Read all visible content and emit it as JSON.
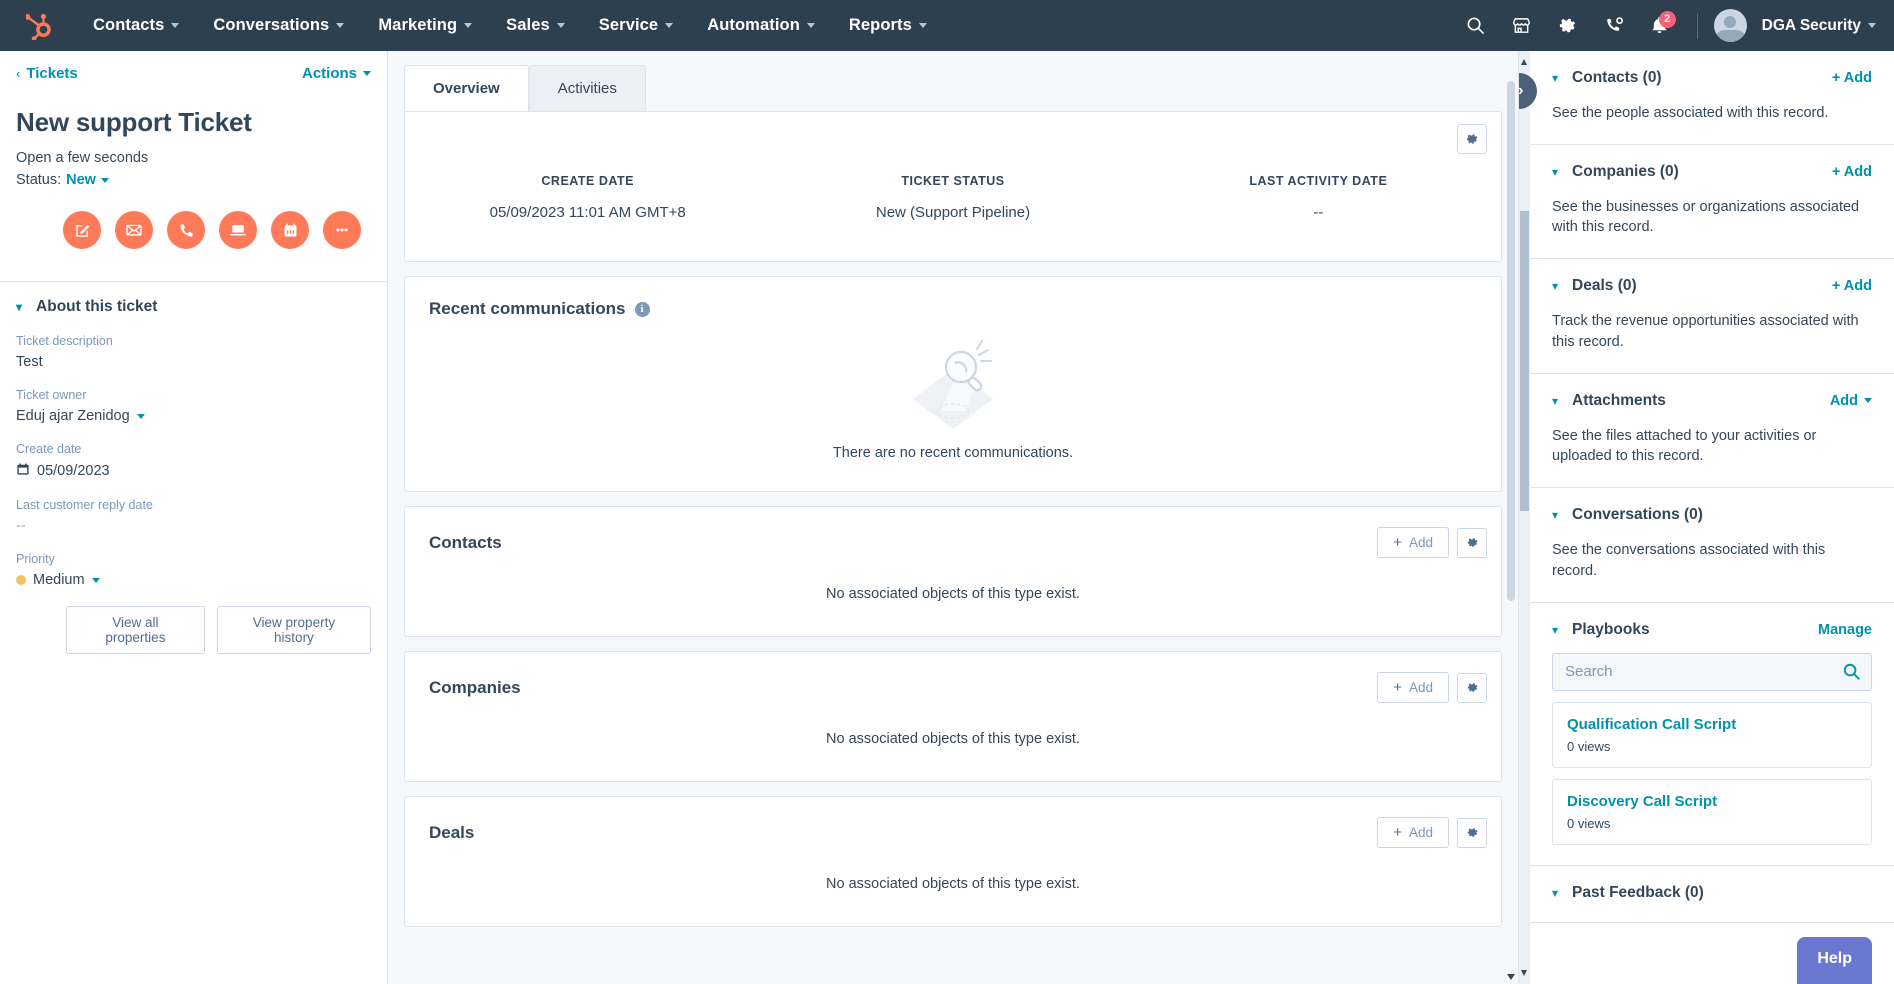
{
  "topnav": {
    "logo_icon": "hubspot-logo-icon",
    "menu": [
      {
        "label": "Contacts",
        "icon": "chevron-down-icon"
      },
      {
        "label": "Conversations",
        "icon": "chevron-down-icon"
      },
      {
        "label": "Marketing",
        "icon": "chevron-down-icon"
      },
      {
        "label": "Sales",
        "icon": "chevron-down-icon"
      },
      {
        "label": "Service",
        "icon": "chevron-down-icon"
      },
      {
        "label": "Automation",
        "icon": "chevron-down-icon"
      },
      {
        "label": "Reports",
        "icon": "chevron-down-icon"
      }
    ],
    "icons": [
      {
        "name": "search-icon"
      },
      {
        "name": "marketplace-icon"
      },
      {
        "name": "gear-icon"
      },
      {
        "name": "calling-icon"
      },
      {
        "name": "notifications-bell-icon"
      }
    ],
    "notification_count": "2",
    "account": {
      "name": "DGA Security",
      "avatar": "user-avatar-icon"
    },
    "accent_color": "#ff7a59",
    "background_color": "#2e3f50"
  },
  "left_panel": {
    "breadcrumb": "Tickets",
    "actions_label": "Actions",
    "record_title": "New support Ticket",
    "record_subtitle": "Open a few seconds",
    "status_label": "Status:",
    "status_value": "New",
    "quick_actions": [
      {
        "name": "note-icon",
        "label": "Note"
      },
      {
        "name": "email-icon",
        "label": "Email"
      },
      {
        "name": "call-icon",
        "label": "Call"
      },
      {
        "name": "meeting-icon",
        "label": "Meeting"
      },
      {
        "name": "task-icon",
        "label": "Task"
      },
      {
        "name": "more-ellipsis-icon",
        "label": "More"
      }
    ],
    "about_section_title": "About this ticket",
    "properties": [
      {
        "label": "Ticket description",
        "value": "Test",
        "type": "text"
      },
      {
        "label": "Ticket owner",
        "value": "Eduj ajar Zenidog",
        "type": "dropdown"
      },
      {
        "label": "Create date",
        "value": "05/09/2023",
        "type": "date"
      },
      {
        "label": "Last customer reply date",
        "value": "--",
        "type": "empty"
      },
      {
        "label": "Priority",
        "value": "Medium",
        "type": "priority",
        "dot_color": "#f5c26b"
      }
    ],
    "buttons": [
      {
        "label": "View all properties"
      },
      {
        "label": "View property history"
      }
    ]
  },
  "center": {
    "tabs": [
      {
        "label": "Overview",
        "active": true
      },
      {
        "label": "Activities",
        "active": false
      }
    ],
    "summary": {
      "columns": [
        {
          "label": "CREATE DATE",
          "value": "05/09/2023 11:01 AM GMT+8"
        },
        {
          "label": "TICKET STATUS",
          "value": "New (Support Pipeline)"
        },
        {
          "label": "LAST ACTIVITY DATE",
          "value": "--"
        }
      ],
      "gear_icon": "gear-icon"
    },
    "recent_communications": {
      "title": "Recent communications",
      "info_icon": "info-icon",
      "empty_text": "There are no recent communications.",
      "illustration": "magnifier-empty-state-icon"
    },
    "association_cards": [
      {
        "title": "Contacts",
        "add_label": "Add",
        "empty_text": "No associated objects of this type exist."
      },
      {
        "title": "Companies",
        "add_label": "Add",
        "empty_text": "No associated objects of this type exist."
      },
      {
        "title": "Deals",
        "add_label": "Add",
        "empty_text": "No associated objects of this type exist."
      }
    ]
  },
  "right_panel": {
    "collapse_icon": "double-chevron-right-icon",
    "sections": [
      {
        "title": "Contacts (0)",
        "action": "+ Add",
        "description": "See the people associated with this record."
      },
      {
        "title": "Companies (0)",
        "action": "+ Add",
        "description": "See the businesses or organizations associated with this record."
      },
      {
        "title": "Deals (0)",
        "action": "+ Add",
        "description": "Track the revenue opportunities associated with this record."
      },
      {
        "title": "Attachments",
        "action": "Add",
        "action_caret": true,
        "description": "See the files attached to your activities or uploaded to this record."
      },
      {
        "title": "Conversations (0)",
        "action": "",
        "description": "See the conversations associated with this record."
      }
    ],
    "playbooks": {
      "title": "Playbooks",
      "manage_label": "Manage",
      "search_placeholder": "Search",
      "search_value": "",
      "search_icon": "search-icon",
      "items": [
        {
          "name": "Qualification Call Script",
          "views": "0 views"
        },
        {
          "name": "Discovery Call Script",
          "views": "0 views"
        }
      ]
    },
    "past_feedback": {
      "title": "Past Feedback (0)"
    }
  },
  "help_button": {
    "label": "Help",
    "color": "#6a78d1"
  }
}
